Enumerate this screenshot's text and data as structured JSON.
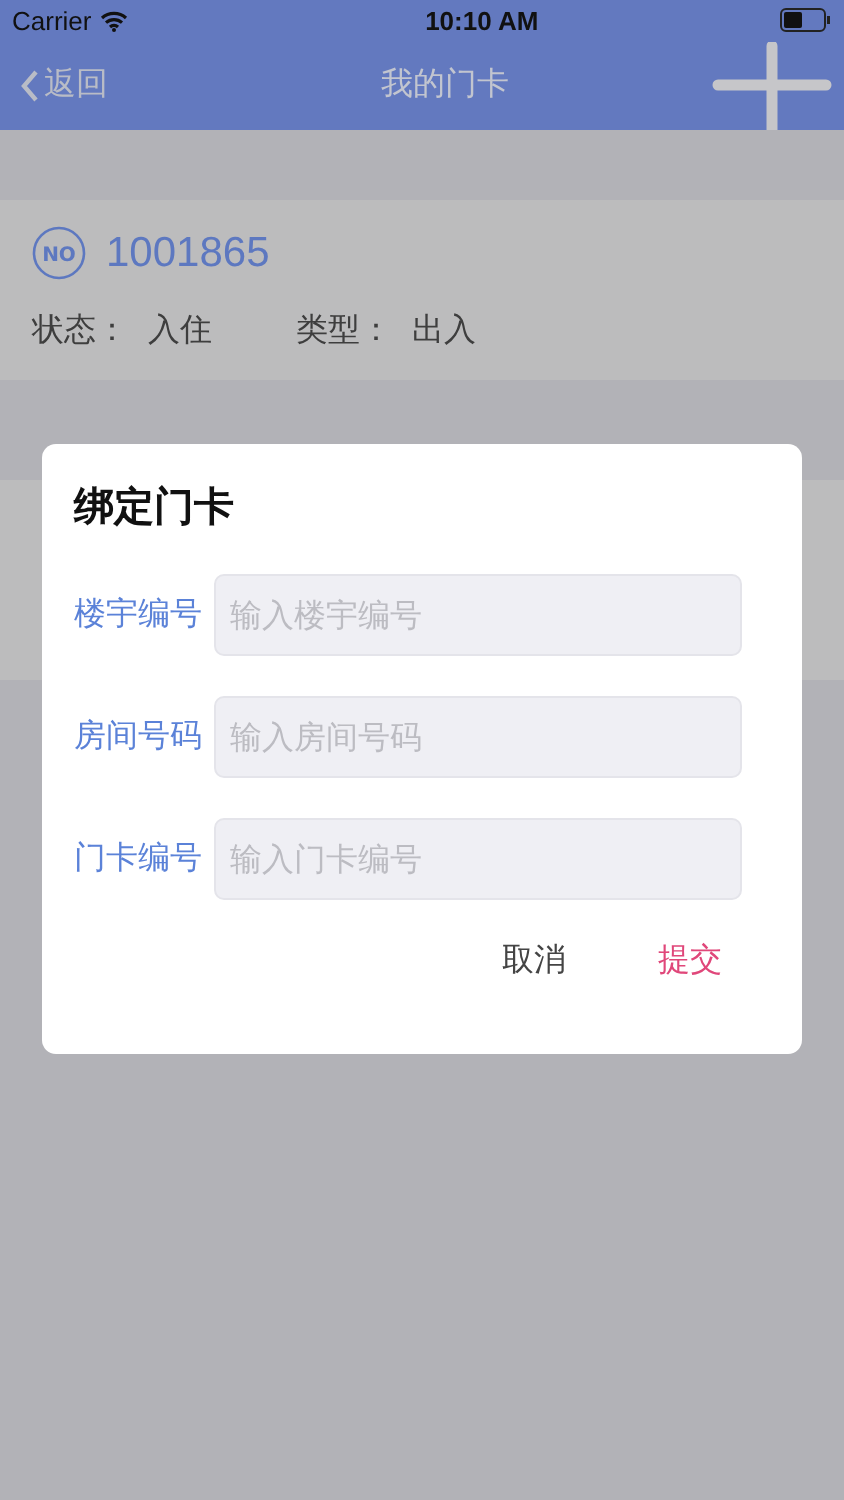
{
  "status_bar": {
    "carrier": "Carrier",
    "time": "10:10 AM"
  },
  "nav": {
    "back": "返回",
    "title": "我的门卡"
  },
  "card": {
    "badge": "NO",
    "number": "1001865",
    "status_label": "状态：",
    "status": "入住",
    "type_label": "类型：",
    "type": "出入"
  },
  "dialog": {
    "title": "绑定门卡",
    "fields": [
      {
        "label": "楼宇编号",
        "placeholder": "输入楼宇编号"
      },
      {
        "label": "房间号码",
        "placeholder": "输入房间号码"
      },
      {
        "label": "门卡编号",
        "placeholder": "输入门卡编号"
      }
    ],
    "buttons": [
      {
        "label": "取消",
        "kind": "cancel"
      },
      {
        "label": "提交",
        "kind": "submit"
      }
    ]
  }
}
